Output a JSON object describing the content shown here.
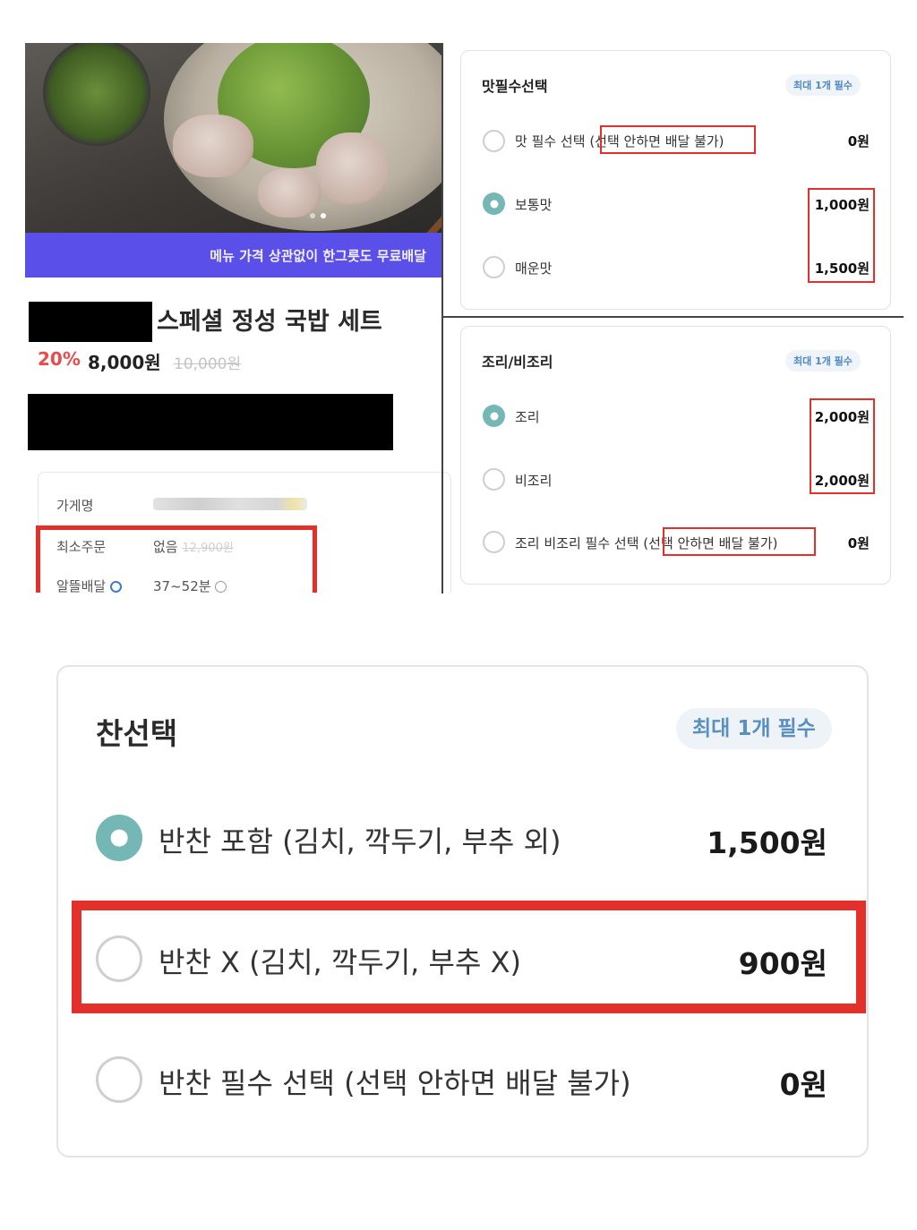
{
  "product": {
    "promo_banner": "메뉴 가격 상관없이 한그릇도 무료배달",
    "title": "스페셜 정성 국밥 세트",
    "discount_rate": "20%",
    "price": "8,000원",
    "original_price": "10,000원",
    "info": {
      "store_label": "가게명",
      "min_order_label": "최소주문",
      "min_order_value": "없음",
      "min_order_old": "12,900원",
      "delivery_label": "알뜰배달",
      "delivery_time": "37~52분"
    }
  },
  "taste_card": {
    "title": "맛필수선택",
    "badge": "최대 1개 필수",
    "options": [
      {
        "label": "맛 필수 선택",
        "note": "(선택 안하면 배달 불가)",
        "price": "0원",
        "selected": false
      },
      {
        "label": "보통맛",
        "price": "1,000원",
        "selected": true
      },
      {
        "label": "매운맛",
        "price": "1,500원",
        "selected": false
      }
    ]
  },
  "cook_card": {
    "title": "조리/비조리",
    "badge": "최대 1개 필수",
    "options": [
      {
        "label": "조리",
        "price": "2,000원",
        "selected": true
      },
      {
        "label": "비조리",
        "price": "2,000원",
        "selected": false
      },
      {
        "label": "조리 비조리 필수 선택",
        "note": "(선택 안하면 배달 불가)",
        "price": "0원",
        "selected": false
      }
    ]
  },
  "side_card": {
    "title": "찬선택",
    "badge": "최대 1개 필수",
    "options": [
      {
        "label": "반찬 포함 (김치, 깍두기, 부추 외)",
        "price": "1,500원",
        "selected": true
      },
      {
        "label": "반찬 X (김치, 깍두기, 부추 X)",
        "price": "900원",
        "selected": false
      },
      {
        "label": "반찬 필수 선택 (선택 안하면 배달 불가)",
        "price": "0원",
        "selected": false
      }
    ]
  },
  "colors": {
    "accent_purple": "#5b4fe9",
    "discount_red": "#ea4b4b",
    "highlight_red": "#e4302b",
    "radio_selected": "#75b7b5",
    "badge_blue": "#4f88c6"
  }
}
